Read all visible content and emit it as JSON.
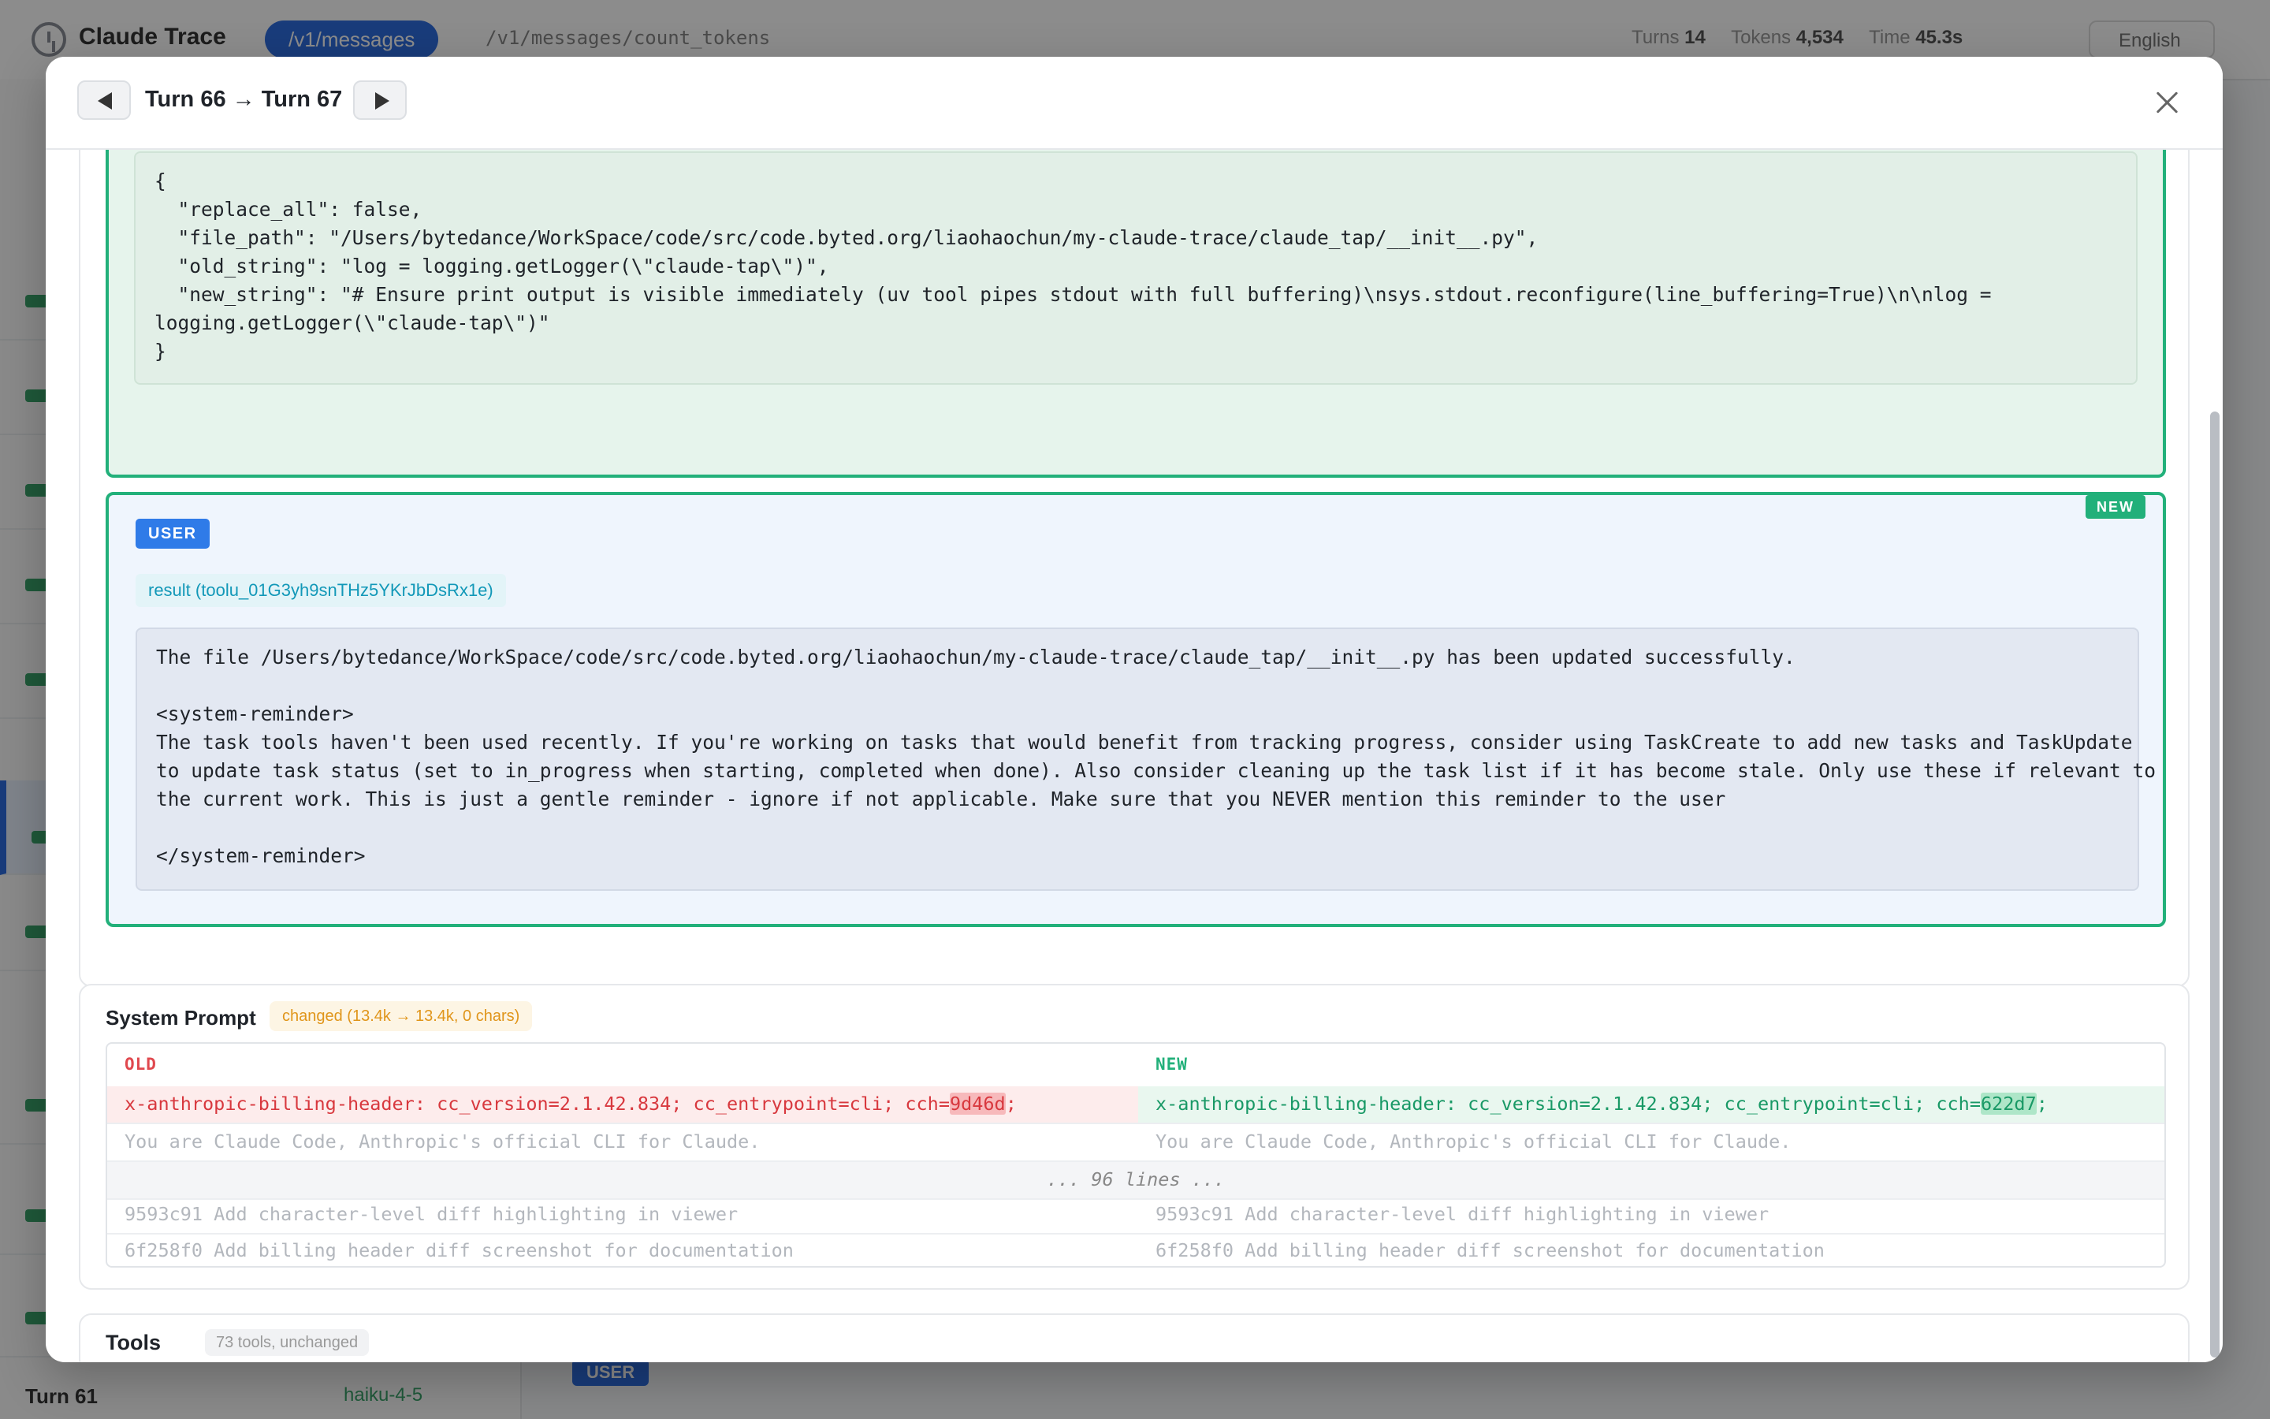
{
  "app": {
    "title": "Claude Trace",
    "active_endpoint": "/v1/messages",
    "other_endpoint": "/v1/messages/count_tokens",
    "stats": {
      "turns_label": "Turns",
      "turns_value": "14",
      "tokens_label": "Tokens",
      "tokens_value": "4,534",
      "time_label": "Time",
      "time_value": "45.3s"
    },
    "language": "English",
    "last_turn_label": "Turn 61",
    "last_turn_model": "haiku-4-5",
    "bg_user_badge": "USER"
  },
  "modal": {
    "title": "Turn 66 → Turn 67",
    "prev_icon": "triangle-left-icon",
    "next_icon": "triangle-right-icon",
    "close_icon": "close-icon"
  },
  "tool_message": {
    "code": "{\n  \"replace_all\": false,\n  \"file_path\": \"/Users/bytedance/WorkSpace/code/src/code.byted.org/liaohaochun/my-claude-trace/claude_tap/__init__.py\",\n  \"old_string\": \"log = logging.getLogger(\\\"claude-tap\\\")\",\n  \"new_string\": \"# Ensure print output is visible immediately (uv tool pipes stdout with full buffering)\\nsys.stdout.reconfigure(line_buffering=True)\\n\\nlog =\nlogging.getLogger(\\\"claude-tap\\\")\"\n}"
  },
  "user_message": {
    "role_badge": "USER",
    "new_badge": "NEW",
    "result_label": "result (toolu_01G3yh9snTHz5YKrJbDsRx1e)",
    "content": "The file /Users/bytedance/WorkSpace/code/src/code.byted.org/liaohaochun/my-claude-trace/claude_tap/__init__.py has been updated successfully.\n\n<system-reminder>\nThe task tools haven't been used recently. If you're working on tasks that would benefit from tracking progress, consider using TaskCreate to add new tasks and TaskUpdate\nto update task status (set to in_progress when starting, completed when done). Also consider cleaning up the task list if it has become stale. Only use these if relevant to\nthe current work. This is just a gentle reminder - ignore if not applicable. Make sure that you NEVER mention this reminder to the user\n\n</system-reminder>"
  },
  "system_prompt": {
    "title": "System Prompt",
    "changed_label": "changed (13.4k → 13.4k, 0 chars)",
    "old_header": "OLD",
    "new_header": "NEW",
    "changed_row": {
      "old_prefix": "x-anthropic-billing-header: cc_version=2.1.42.834; cc_entrypoint=cli; cch=",
      "old_highlight": "9d46d",
      "old_suffix": ";",
      "new_prefix": "x-anthropic-billing-header: cc_version=2.1.42.834; cc_entrypoint=cli; cch=",
      "new_highlight": "622d7",
      "new_suffix": ";"
    },
    "context_row_1": "You are Claude Code, Anthropic's official CLI for Claude.",
    "gap_label": "... 96 lines ...",
    "context_row_2": "9593c91 Add character-level diff highlighting in viewer",
    "context_row_3": "6f258f0 Add billing header diff screenshot for documentation"
  },
  "tools": {
    "title": "Tools",
    "meta": "73 tools, unchanged"
  },
  "colors": {
    "accent_blue": "#2f7be8",
    "new_green": "#22b07a",
    "removed_red": "#d8383e",
    "changed_orange": "#e0951a"
  }
}
